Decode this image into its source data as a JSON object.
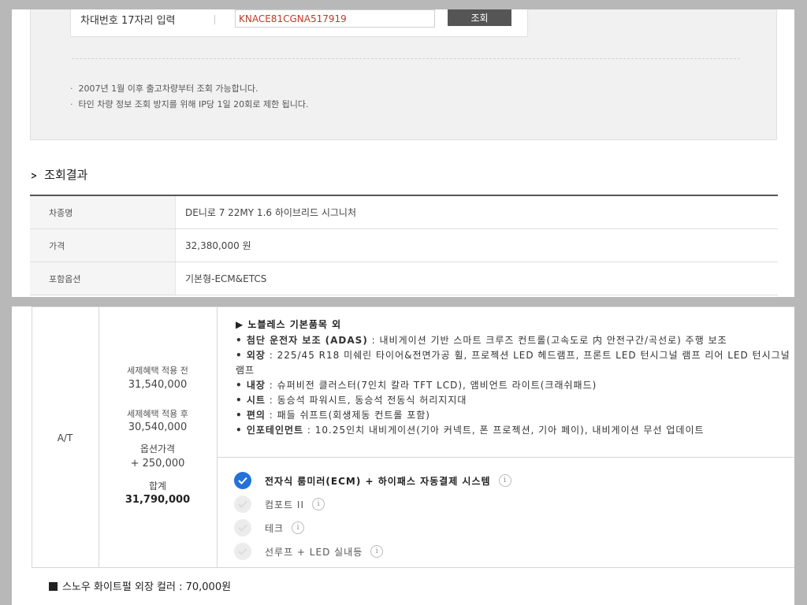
{
  "vin_lookup": {
    "label": "차대번호 17자리 입력",
    "input_value": "KNACE81CGNA517919",
    "button_label": "조회",
    "notes": [
      "2007년 1월 이후 출고차량부터 조회 가능합니다.",
      "타인 차량 정보 조회 방지를 위해 IP당 1일 20회로 제한 됩니다."
    ]
  },
  "result": {
    "title": "조회결과",
    "rows": [
      {
        "label": "차종명",
        "value": "DE니로 7 22MY 1.6 하이브리드 시그니처"
      },
      {
        "label": "가격",
        "value": "32,380,000 원"
      },
      {
        "label": "포함옵션",
        "value": "기본형-ECM&ETCS"
      }
    ]
  },
  "trim": {
    "name": "A/T",
    "before_tax_label": "세제혜택 적용 전",
    "before_tax_value": "31,540,000",
    "after_tax_label": "세제혜택 적용 후",
    "after_tax_value": "30,540,000",
    "option_price_label": "옵션가격",
    "option_price_value": "+ 250,000",
    "total_label": "합계",
    "total_value": "31,790,000"
  },
  "spec": {
    "title": "▶ 노블레스 기본품목 외",
    "items": [
      {
        "key": "• 첨단 운전자 보조 (ADAS)",
        "text": " : 내비게이션 기반 스마트 크루즈 컨트롤(고속도로 内 안전구간/곡선로) 주행 보조"
      },
      {
        "key": "• 외장",
        "text": " : 225/45 R18 미쉐린 타이어&전면가공 휠, 프로젝션 LED 헤드램프, 프론트 LED 턴시그널 램프 리어 LED 턴시그널 램프"
      },
      {
        "key": "• 내장",
        "text": " : 슈퍼비전 클러스터(7인치 칼라 TFT LCD), 앰비언트 라이트(크래쉬패드)"
      },
      {
        "key": "• 시트",
        "text": " : 동승석 파워시트, 동승석 전동식 허리지지대"
      },
      {
        "key": "• 편의",
        "text": " : 패들 쉬프트(회생제동 컨트롤 포함)"
      },
      {
        "key": "• 인포테인먼트",
        "text": " : 10.25인치 내비게이션(기아 커넥트, 폰 프로젝션, 기아 페이), 내비게이션 무선 업데이트"
      }
    ]
  },
  "options": [
    {
      "label": "전자식 룸미러(ECM) + 하이패스 자동결제 시스템",
      "checked": true
    },
    {
      "label": "컴포트 II",
      "checked": false
    },
    {
      "label": "테크",
      "checked": false
    },
    {
      "label": "선루프 + LED 실내등",
      "checked": false
    }
  ],
  "info_icon_text": "i",
  "color_option": "스노우 화이트펄 외장 컬러 : 70,000원",
  "colors": {
    "accent": "#2272d8",
    "vin_text": "#c0392b",
    "button_bg": "#555555"
  }
}
